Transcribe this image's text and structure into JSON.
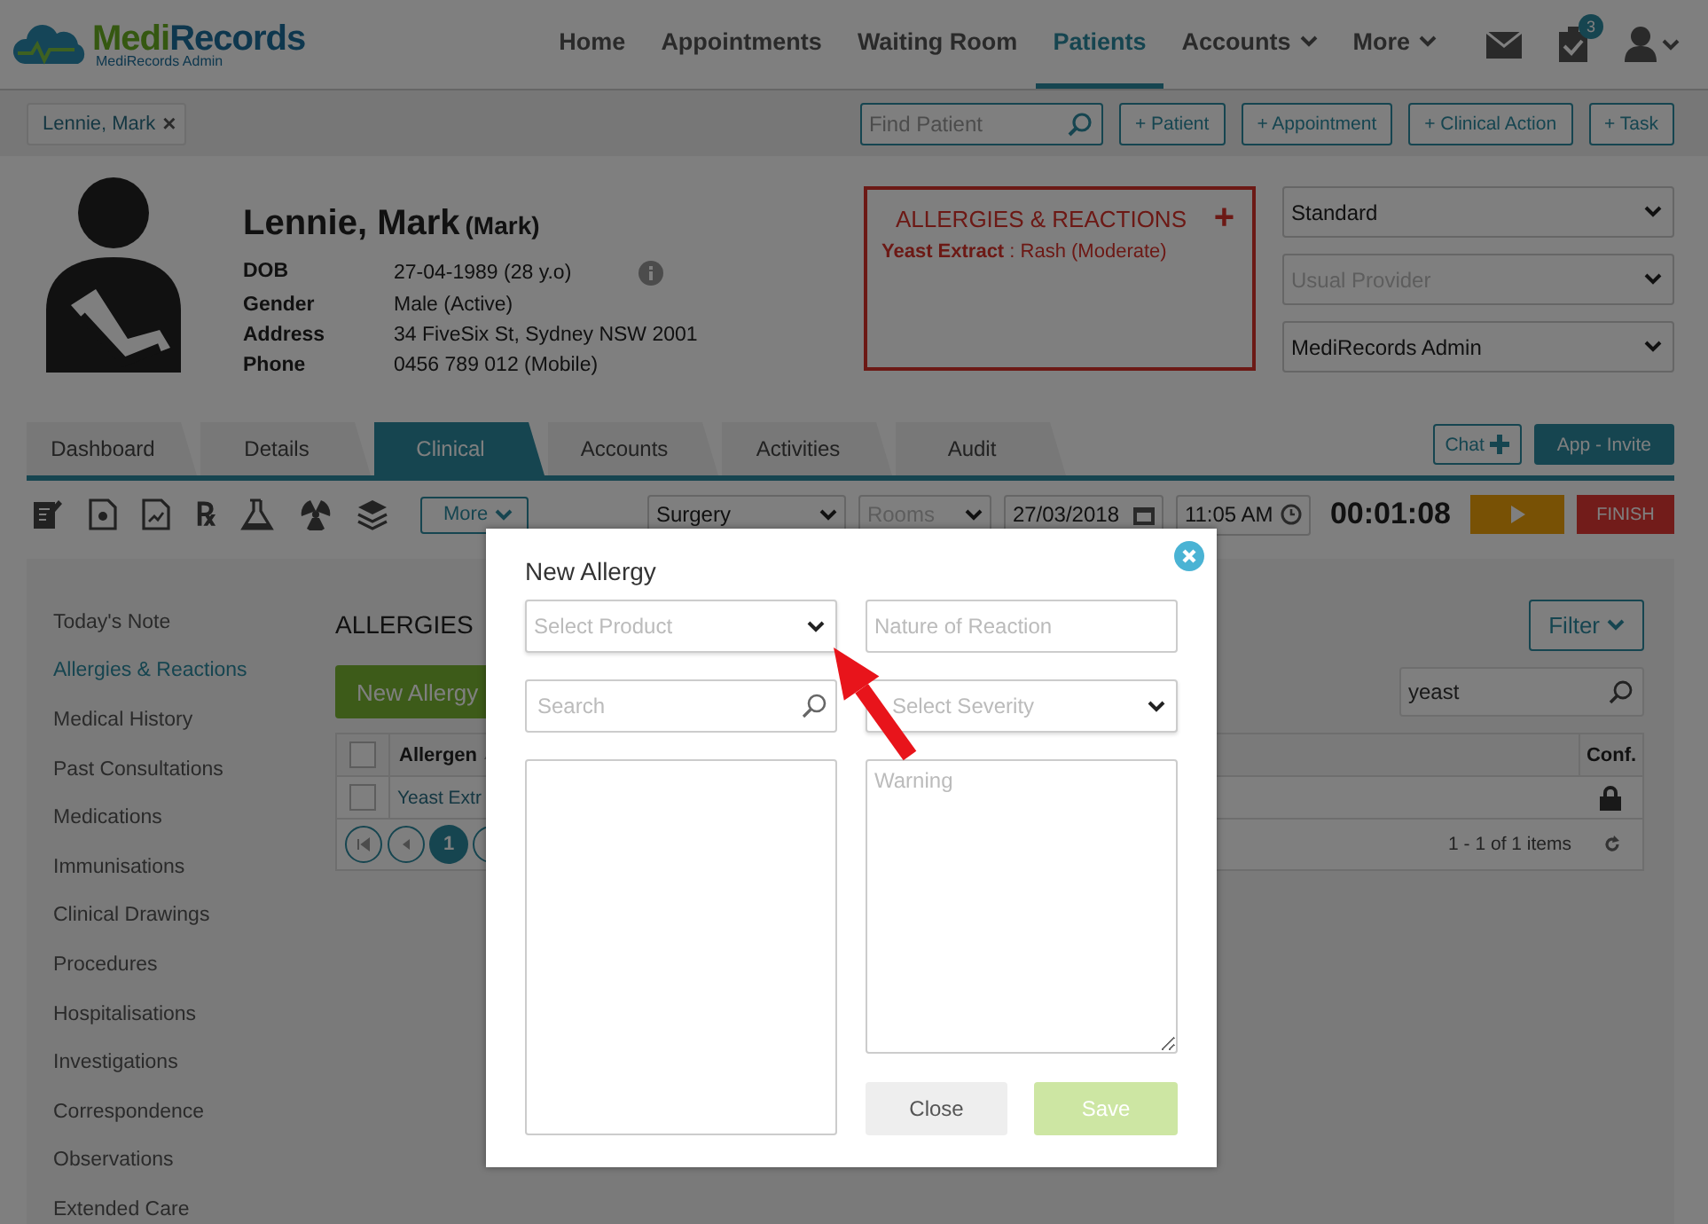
{
  "header": {
    "logo": {
      "first": "Medi",
      "second": "Records",
      "subtitle": "MediRecords Admin"
    },
    "nav": [
      {
        "label": "Home",
        "selected": false,
        "has_menu": false
      },
      {
        "label": "Appointments",
        "selected": false,
        "has_menu": false
      },
      {
        "label": "Waiting Room",
        "selected": false,
        "has_menu": false
      },
      {
        "label": "Patients",
        "selected": true,
        "has_menu": false
      },
      {
        "label": "Accounts",
        "selected": false,
        "has_menu": true
      },
      {
        "label": "More",
        "selected": false,
        "has_menu": true
      }
    ],
    "tasks_badge": "3"
  },
  "patient_bar": {
    "tabs": [
      {
        "label": "Lennie, Mark",
        "close": "×"
      }
    ],
    "find_patient": {
      "placeholder": "Find Patient"
    },
    "actions": [
      "+ Patient",
      "+ Appointment",
      "+ Clinical Action",
      "+ Task"
    ]
  },
  "patient": {
    "name": "Lennie, Mark",
    "preferred": "(Mark)",
    "details": [
      {
        "label": "DOB",
        "value": "27-04-1989 (28 y.o)",
        "info": true
      },
      {
        "label": "Gender",
        "value": "Male (Active)",
        "info": false
      },
      {
        "label": "Address",
        "value": "34 FiveSix St, Sydney NSW 2001",
        "info": false
      },
      {
        "label": "Phone",
        "value": "0456 789 012 (Mobile)",
        "info": false
      }
    ]
  },
  "allergy_panel": {
    "title": "ALLERGIES & REACTIONS",
    "add": "+",
    "entries": [
      {
        "allergen": "Yeast Extract",
        "reaction": " : Rash (Moderate)"
      }
    ]
  },
  "selects": [
    {
      "value": "Standard"
    },
    {
      "placeholder": "Usual Provider"
    },
    {
      "value": "MediRecords Admin"
    }
  ],
  "tabs": [
    {
      "label": "Dashboard",
      "selected": false
    },
    {
      "label": "Details",
      "selected": false
    },
    {
      "label": "Clinical",
      "selected": true
    },
    {
      "label": "Accounts",
      "selected": false
    },
    {
      "label": "Activities",
      "selected": false
    },
    {
      "label": "Audit",
      "selected": false
    }
  ],
  "tab_actions": {
    "chat": "Chat",
    "invite": "App - Invite"
  },
  "clinical_toolbar": {
    "rx": "℞",
    "more": "More",
    "location": "Surgery",
    "room_placeholder": "Rooms",
    "date": "27/03/2018",
    "time": "11:05 AM",
    "timer": "00:01:08",
    "finish": "FINISH"
  },
  "sidebar": [
    {
      "label": "Today's Note",
      "selected": false
    },
    {
      "label": "Allergies & Reactions",
      "selected": true
    },
    {
      "label": "Medical History",
      "selected": false
    },
    {
      "label": "Past Consultations",
      "selected": false
    },
    {
      "label": "Medications",
      "selected": false
    },
    {
      "label": "Immunisations",
      "selected": false
    },
    {
      "label": "Clinical Drawings",
      "selected": false
    },
    {
      "label": "Procedures",
      "selected": false
    },
    {
      "label": "Hospitalisations",
      "selected": false
    },
    {
      "label": "Investigations",
      "selected": false
    },
    {
      "label": "Correspondence",
      "selected": false
    },
    {
      "label": "Observations",
      "selected": false
    },
    {
      "label": "Extended Care",
      "selected": false
    }
  ],
  "allergies": {
    "title": "ALLERGIES",
    "filter": "Filter",
    "new_button": "New Allergy",
    "search": {
      "value": "yeast"
    },
    "table": {
      "select_all_checked": false,
      "columns": [
        "Allergen",
        "Conf."
      ],
      "rows": [
        {
          "checked": false,
          "allergen": "Yeast Extr",
          "confidential": true
        }
      ],
      "pager": {
        "current": "1",
        "summary": "1 - 1 of 1 items"
      }
    }
  },
  "modal": {
    "title": "New Allergy",
    "product_placeholder": "Select Product",
    "reaction_placeholder": "Nature of Reaction",
    "search_placeholder": "Search",
    "severity_placeholder": "Select Severity",
    "warning_placeholder": "Warning",
    "buttons": [
      {
        "label": "Close",
        "kind": "secondary",
        "disabled": false
      },
      {
        "label": "Save",
        "kind": "primary",
        "disabled": true
      }
    ]
  }
}
